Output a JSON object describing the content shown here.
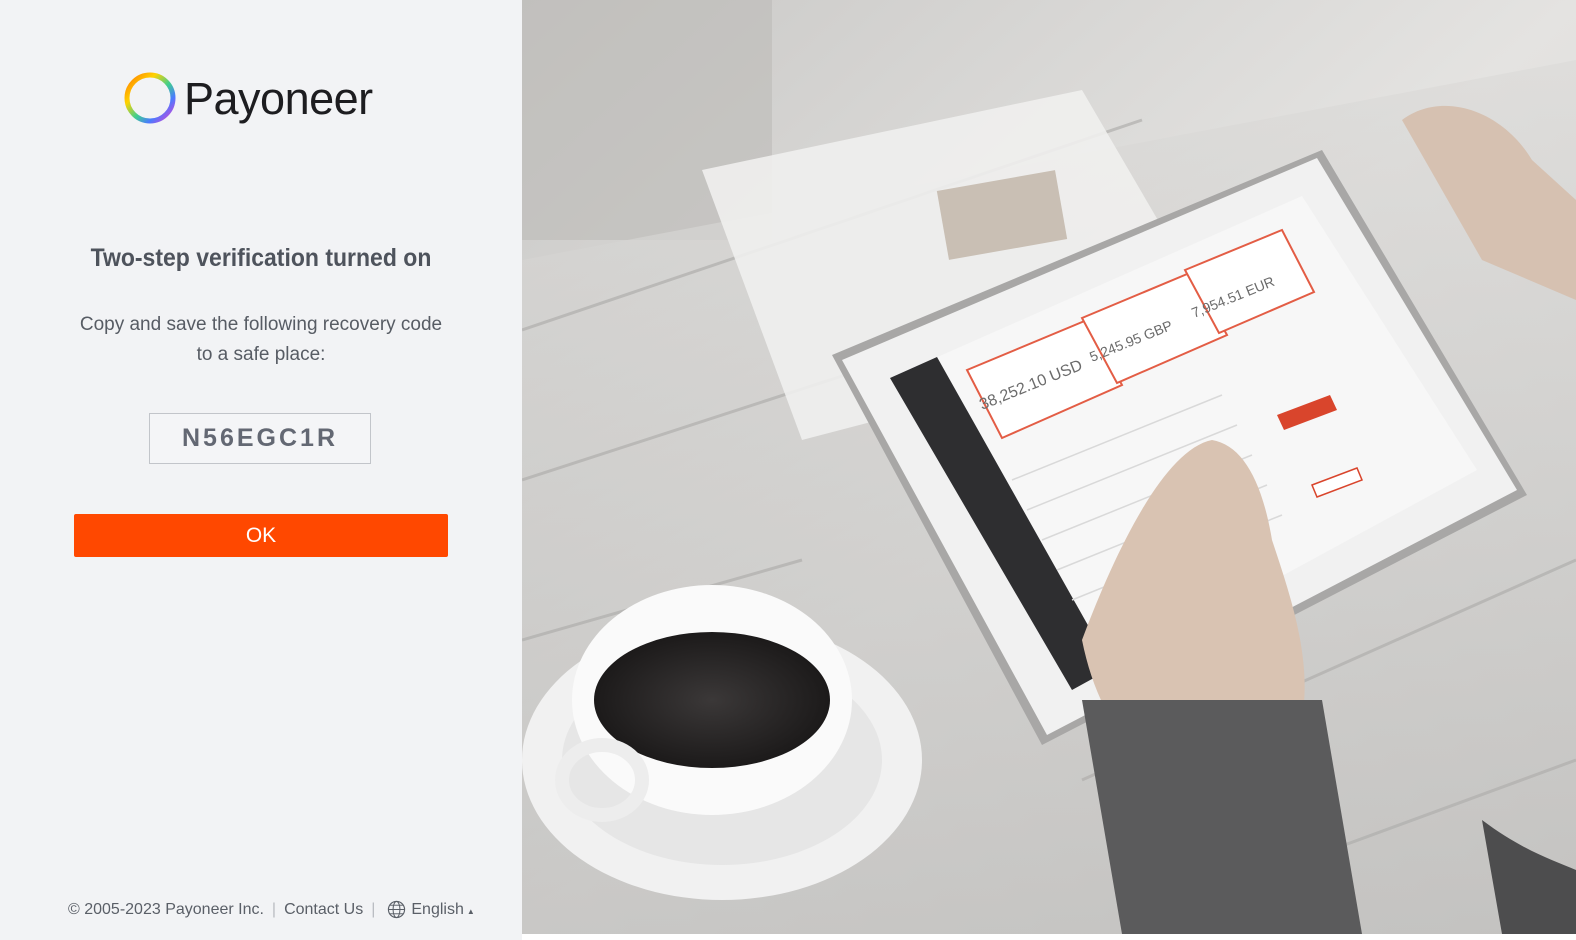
{
  "brand": {
    "name": "Payoneer",
    "logo_icon": "payoneer-ring-logo",
    "accent_color": "#ff4800"
  },
  "dialog": {
    "title": "Two-step verification turned on",
    "instruction_line1": "Copy and save the following recovery code",
    "instruction_line2": "to a safe place:",
    "recovery_code": "N56EGC1R",
    "ok_label": "OK"
  },
  "footer": {
    "copyright": "© 2005-2023 Payoneer Inc.",
    "contact_label": "Contact Us",
    "language_icon": "globe-icon",
    "language_label": "English"
  },
  "hero_image": {
    "description_icon": "hero-photo",
    "tablet_balances": [
      "38,252.10 USD",
      "5,245.95 GBP",
      "7,954.51 EUR"
    ]
  }
}
